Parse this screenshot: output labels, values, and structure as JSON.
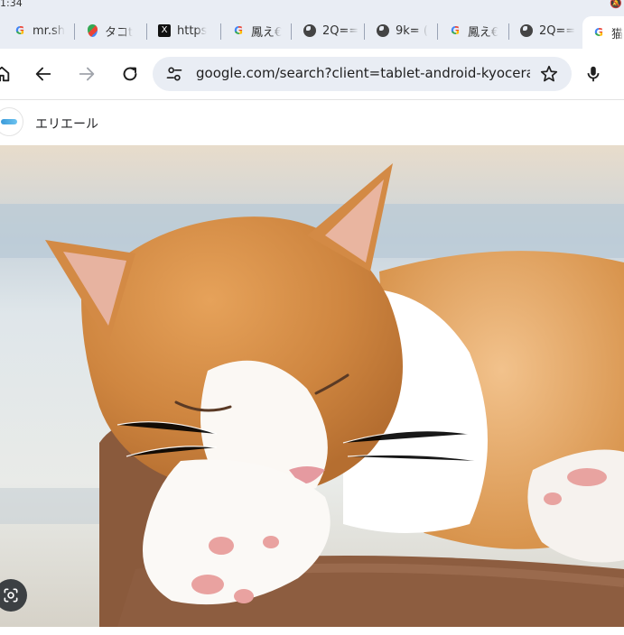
{
  "status": {
    "time": "1:34"
  },
  "tabs": [
    {
      "label": "mr.sh",
      "icon": "google-icon"
    },
    {
      "label": "タコt",
      "icon": "maps-icon"
    },
    {
      "label": "https",
      "icon": "x-icon"
    },
    {
      "label": "鳳え€",
      "icon": "google-icon"
    },
    {
      "label": "2Q==",
      "icon": "globe-icon"
    },
    {
      "label": "9k= (",
      "icon": "globe-icon"
    },
    {
      "label": "鳳え€",
      "icon": "google-icon"
    },
    {
      "label": "2Q==",
      "icon": "globe-icon"
    },
    {
      "label": "猫",
      "icon": "google-icon",
      "active": true
    }
  ],
  "toolbar": {
    "url": "google.com/search?client=tablet-android-kyocera&"
  },
  "result": {
    "site_name": "エリエール"
  },
  "colors": {
    "tabstrip_bg": "#e9edf4",
    "omnibox_bg": "#e9edf4",
    "lens_button_bg": "#3c4043"
  }
}
